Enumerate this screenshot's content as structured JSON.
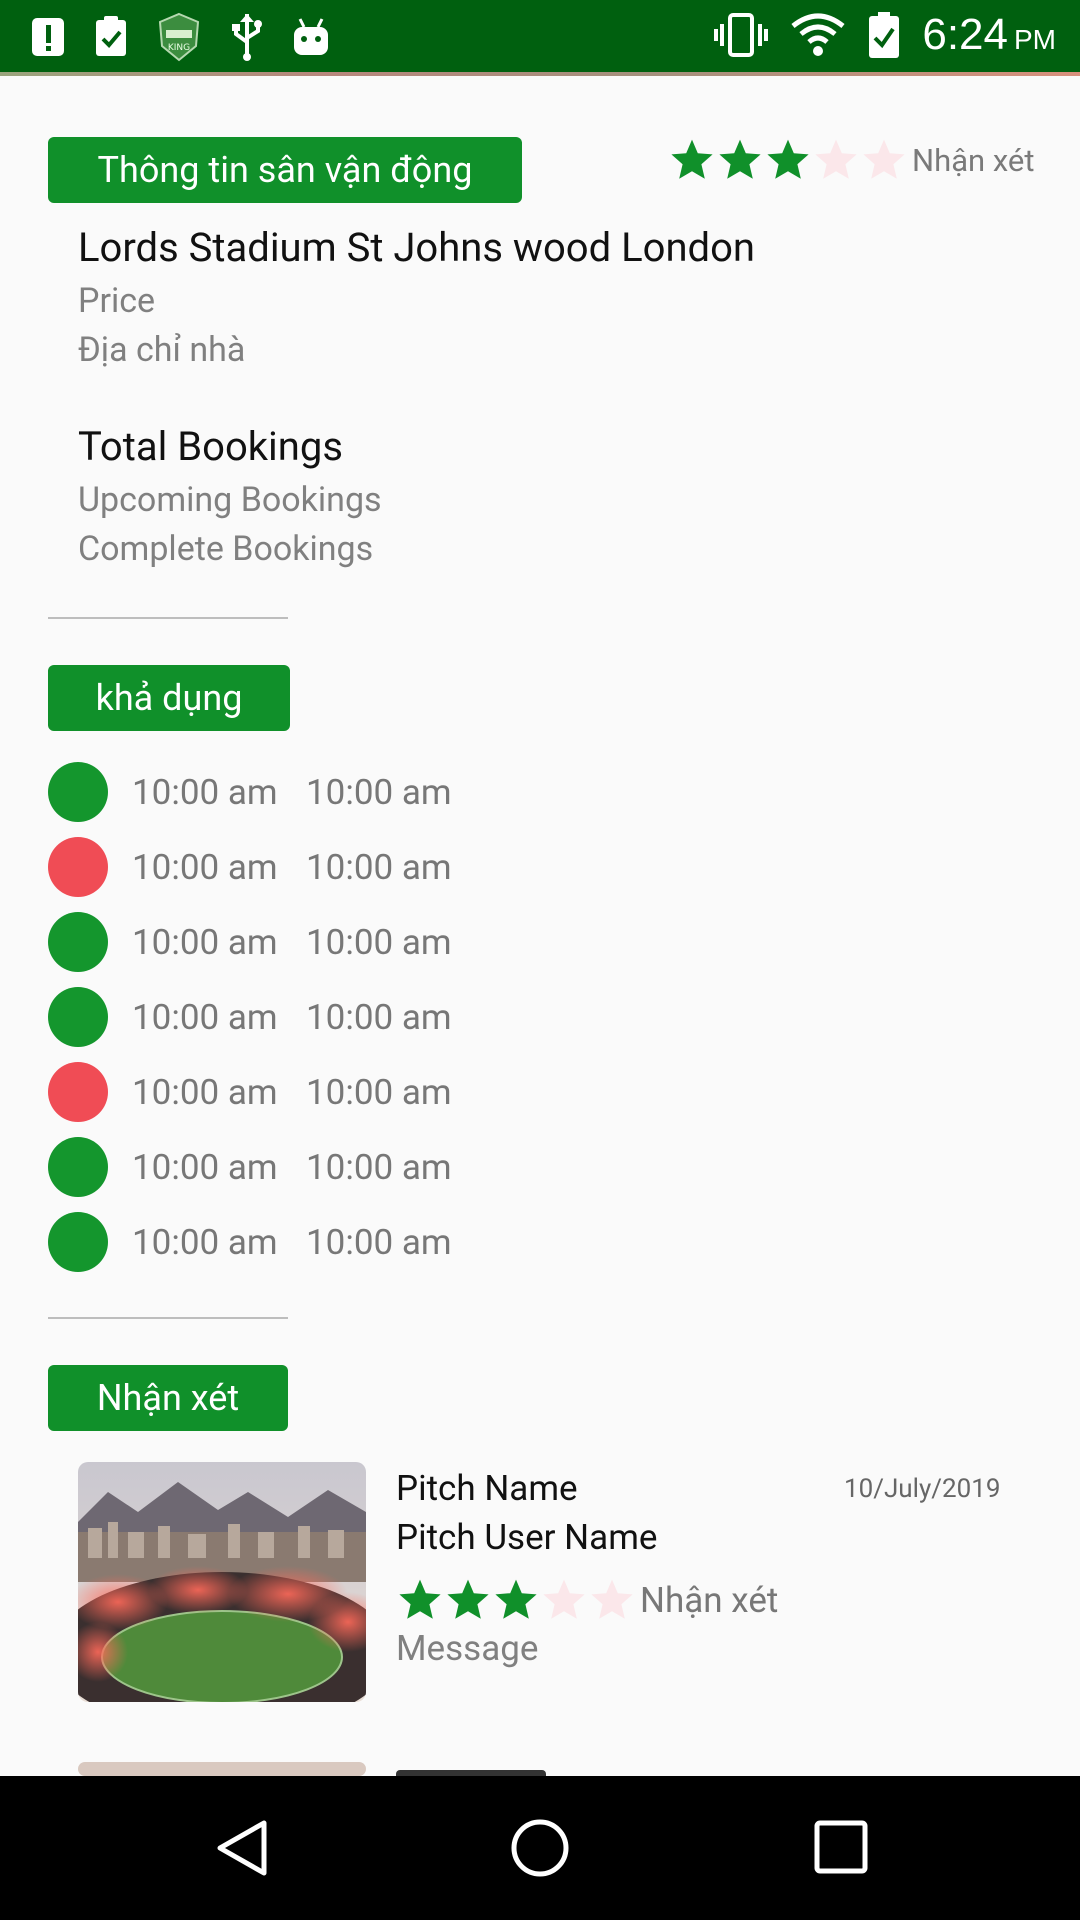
{
  "status_bar": {
    "time": "6:24",
    "ampm": "PM"
  },
  "stadium_info": {
    "button_label": "Thông tin sân vận động",
    "rating_label": "Nhận xét",
    "rating": 3,
    "max_rating": 5,
    "name": "Lords Stadium St Johns wood London",
    "price_label": "Price",
    "address_label": "Địa chỉ nhà"
  },
  "bookings": {
    "total_label": "Total Bookings",
    "upcoming_label": "Upcoming Bookings",
    "complete_label": "Complete Bookings"
  },
  "availability": {
    "button_label": "khả dụng",
    "slots": [
      {
        "start": "10:00 am",
        "end": "10:00 am",
        "status": "available"
      },
      {
        "start": "10:00 am",
        "end": "10:00 am",
        "status": "booked"
      },
      {
        "start": "10:00 am",
        "end": "10:00 am",
        "status": "available"
      },
      {
        "start": "10:00 am",
        "end": "10:00 am",
        "status": "available"
      },
      {
        "start": "10:00 am",
        "end": "10:00 am",
        "status": "booked"
      },
      {
        "start": "10:00 am",
        "end": "10:00 am",
        "status": "available"
      },
      {
        "start": "10:00 am",
        "end": "10:00 am",
        "status": "available"
      }
    ]
  },
  "reviews": {
    "button_label": "Nhận xét",
    "items": [
      {
        "pitch_name": "Pitch Name",
        "user_name": "Pitch User Name",
        "date": "10/July/2019",
        "rating": 3,
        "rating_label": "Nhận xét",
        "message": "Message"
      }
    ]
  },
  "colors": {
    "primary_green": "#10902a",
    "status_bar_green": "#00600f",
    "available": "#14962d",
    "booked": "#f04c55",
    "star_empty": "#fbe7ea"
  }
}
